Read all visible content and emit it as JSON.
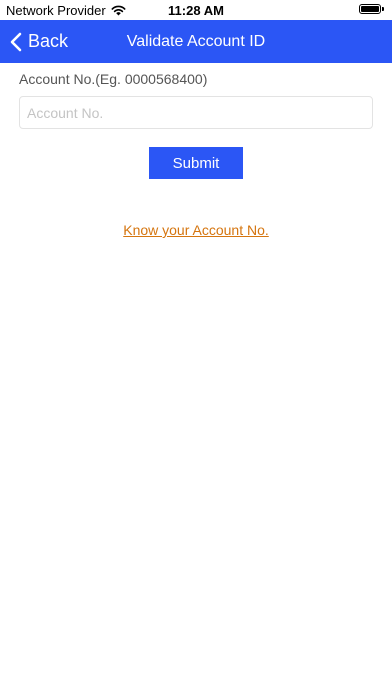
{
  "status_bar": {
    "carrier": "Network Provider",
    "time": "11:28 AM",
    "wifi_icon": "wifi-icon",
    "battery_icon": "battery-full-icon"
  },
  "nav": {
    "back_label": "Back",
    "back_icon": "chevron-left-icon",
    "title": "Validate Account ID",
    "background_color": "#2b56f5"
  },
  "form": {
    "account_label": "Account No.(Eg. 0000568400)",
    "account_value": "",
    "account_placeholder": "Account No.",
    "submit_label": "Submit",
    "submit_color": "#2b56f5"
  },
  "links": {
    "know_account": "Know your Account No.",
    "link_color": "#d5750f"
  }
}
